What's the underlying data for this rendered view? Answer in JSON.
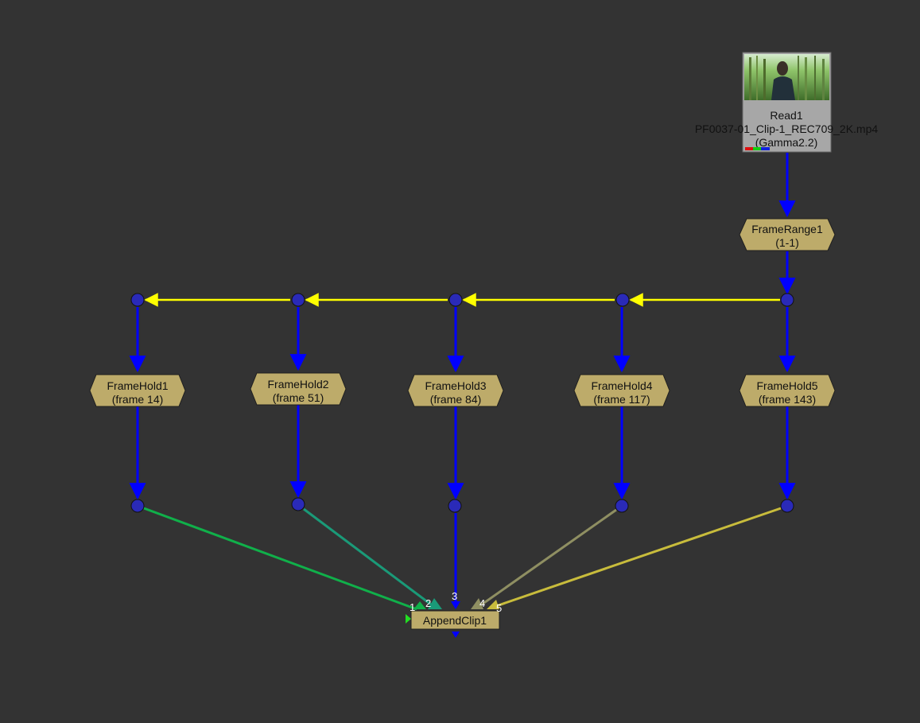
{
  "app": "Nuke Node Graph",
  "colors": {
    "background": "#333333",
    "pipe_main": "#0000ff",
    "pipe_expression": "#ffff00",
    "dot_fill": "#2a2ab8",
    "node_fill": "#bdab6a",
    "node_fill_dark": "#a89554",
    "read_fill": "#a7a7a7",
    "input_1": "#10b04a",
    "input_2": "#1a9a78",
    "input_3": "#0000ff",
    "input_4": "#8f8f62",
    "input_5": "#c8bc3c"
  },
  "read_node": {
    "name": "Read1",
    "file": "PF0037-01_Clip-1_REC709_2K.mp4",
    "colorspace": "(Gamma2.2)",
    "thumbnail": "forest-thumbnail"
  },
  "frame_range": {
    "name": "FrameRange1",
    "detail": "(1-1)"
  },
  "frame_holds": [
    {
      "name": "FrameHold1",
      "detail": "(frame 14)"
    },
    {
      "name": "FrameHold2",
      "detail": "(frame 51)"
    },
    {
      "name": "FrameHold3",
      "detail": "(frame 84)"
    },
    {
      "name": "FrameHold4",
      "detail": "(frame 117)"
    },
    {
      "name": "FrameHold5",
      "detail": "(frame 143)"
    }
  ],
  "append_clip": {
    "name": "AppendClip1",
    "inputs": [
      "1",
      "2",
      "3",
      "4",
      "5"
    ]
  }
}
